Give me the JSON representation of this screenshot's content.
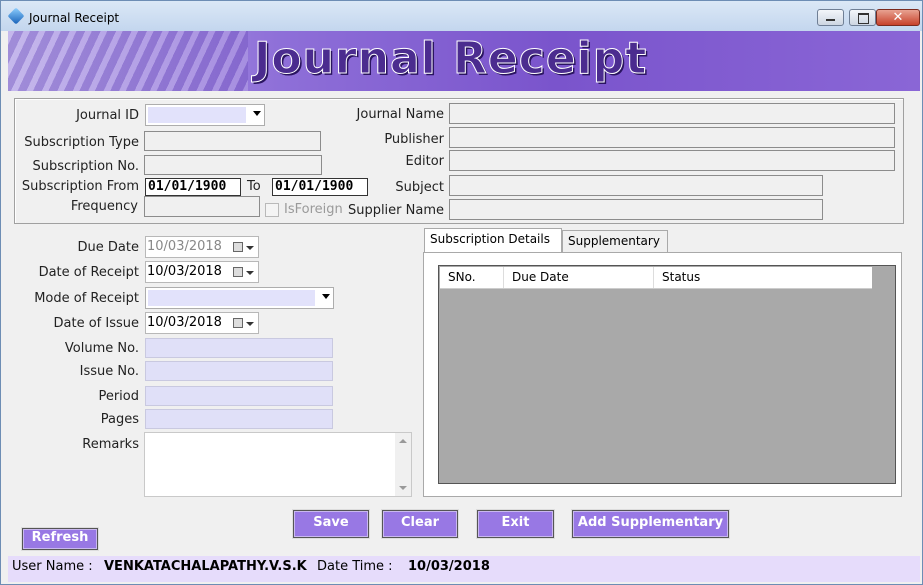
{
  "window": {
    "title": "Journal Receipt"
  },
  "banner": {
    "title": "Journal Receipt"
  },
  "journal": {
    "journal_id_label": "Journal ID",
    "subscription_type_label": "Subscription Type",
    "subscription_no_label": "Subscription No.",
    "subscription_from_label": "Subscription From",
    "subscription_from_value": "01/01/1900",
    "to_label": "To",
    "to_value": "01/01/1900",
    "frequency_label": "Frequency",
    "isforeign_label": "IsForeign",
    "journal_name_label": "Journal Name",
    "publisher_label": "Publisher",
    "editor_label": "Editor",
    "subject_label": "Subject",
    "supplier_name_label": "Supplier Name"
  },
  "receipt": {
    "due_date_label": "Due Date",
    "due_date_value": "10/03/2018",
    "date_of_receipt_label": "Date of Receipt",
    "date_of_receipt_value": "10/03/2018",
    "mode_of_receipt_label": "Mode of Receipt",
    "date_of_issue_label": "Date of Issue",
    "date_of_issue_value": "10/03/2018",
    "volume_no_label": "Volume No.",
    "issue_no_label": "Issue No.",
    "period_label": "Period",
    "pages_label": "Pages",
    "remarks_label": "Remarks"
  },
  "tabs": [
    {
      "label": "Subscription Details",
      "active": true
    },
    {
      "label": "Supplementary",
      "active": false
    }
  ],
  "grid": {
    "columns": [
      "SNo.",
      "Due Date",
      "Status"
    ]
  },
  "buttons": {
    "save": "Save",
    "clear": "Clear",
    "exit": "Exit",
    "add_supplementary": "Add Supplementary",
    "refresh": "Refresh"
  },
  "status": {
    "user_label": "User Name :",
    "user_value": "VENKATACHALAPATHY.V.S.K",
    "datetime_label": "Date Time :",
    "datetime_value": "10/03/2018"
  },
  "colors": {
    "accent": "#9878e4",
    "banner": "#7a54cc",
    "status_bar": "#e6dcfb",
    "field_fill": "#e0e0f8"
  }
}
